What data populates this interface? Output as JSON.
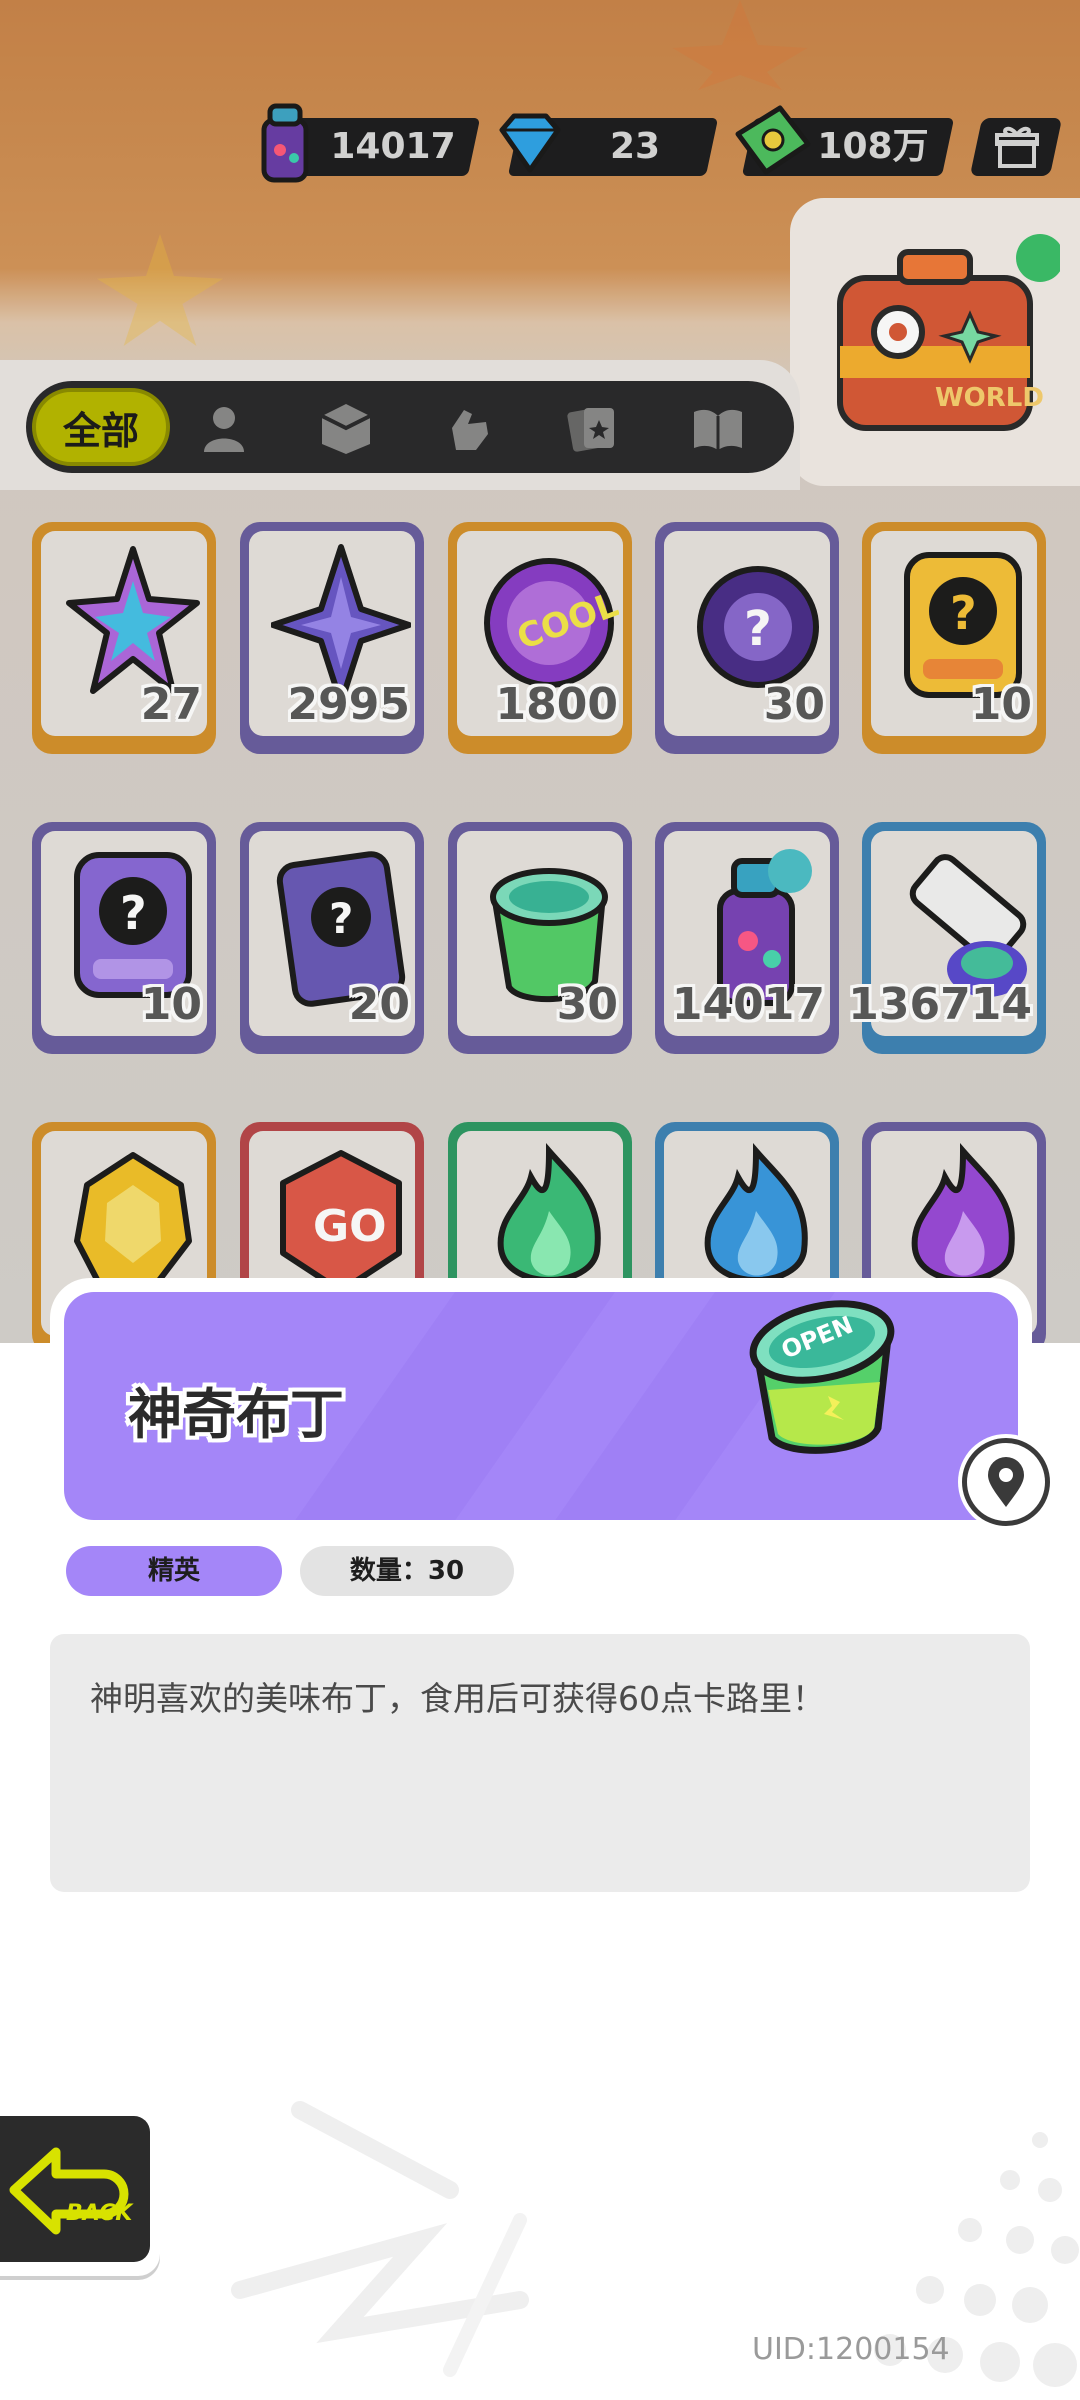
{
  "currencies": [
    {
      "icon": "spray-can-icon",
      "value": "14017"
    },
    {
      "icon": "diamond-icon",
      "value": "23"
    },
    {
      "icon": "banknote-icon",
      "value": "108万"
    }
  ],
  "world_card": {
    "label": "WORLD",
    "icon": "travel-suitcase-icon"
  },
  "categories": [
    {
      "label": "全部",
      "icon": "all-icon",
      "selected": true
    },
    {
      "label": "",
      "icon": "person-icon"
    },
    {
      "label": "",
      "icon": "box-icon"
    },
    {
      "label": "",
      "icon": "hand-icon"
    },
    {
      "label": "",
      "icon": "cards-icon"
    },
    {
      "label": "",
      "icon": "book-icon"
    }
  ],
  "items": [
    {
      "icon": "rainbow-star-icon",
      "count": "27",
      "frame": "orange"
    },
    {
      "icon": "purple-star-icon",
      "count": "2995",
      "frame": "purple"
    },
    {
      "icon": "cool-badge-icon",
      "count": "1800",
      "frame": "orange"
    },
    {
      "icon": "mystery-orb-icon",
      "count": "30",
      "frame": "purple"
    },
    {
      "icon": "deity-card-gold-icon",
      "count": "10",
      "frame": "orange"
    },
    {
      "icon": "deity-card-purple-icon",
      "count": "10",
      "frame": "purple"
    },
    {
      "icon": "travel-card-icon",
      "count": "20",
      "frame": "purple"
    },
    {
      "icon": "pudding-icon",
      "count": "30",
      "frame": "purple"
    },
    {
      "icon": "spray-can-icon",
      "count": "14017",
      "frame": "purple"
    },
    {
      "icon": "paint-tube-icon",
      "count": "136714",
      "frame": "blue"
    },
    {
      "icon": "gold-crystal-icon",
      "count": "",
      "frame": "orange"
    },
    {
      "icon": "go-dice-icon",
      "count": "",
      "frame": "red"
    },
    {
      "icon": "green-flame-icon",
      "count": "",
      "frame": "green"
    },
    {
      "icon": "blue-flame-icon",
      "count": "",
      "frame": "blue"
    },
    {
      "icon": "purple-flame-icon",
      "count": "",
      "frame": "purple"
    }
  ],
  "detail": {
    "name": "神奇布丁",
    "rarity": "精英",
    "quantity_label": "数量：30",
    "description": "神明喜欢的美味布丁，食用后可获得60点卡路里！",
    "banner_color": "#a486f8",
    "item_icon": "pudding-icon",
    "item_badge": "OPEN"
  },
  "back_button": {
    "label": "BACK"
  },
  "uid": "UID:1200154",
  "colors": {
    "accent_yellow": "#b8b900",
    "elite_purple": "#a486f8",
    "dark": "#2a2a2c"
  }
}
